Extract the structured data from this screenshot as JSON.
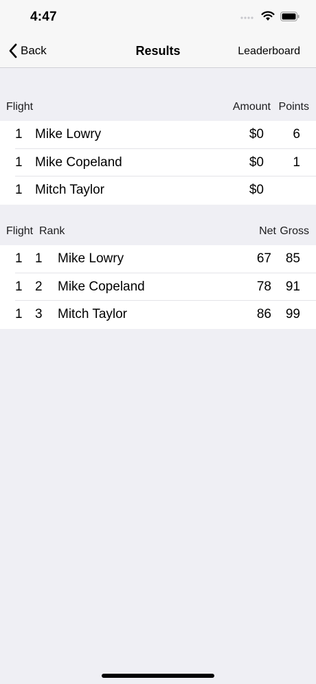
{
  "status_bar": {
    "time": "4:47"
  },
  "nav": {
    "back_label": "Back",
    "title": "Results",
    "leaderboard_label": "Leaderboard"
  },
  "payout_section": {
    "headers": {
      "flight": "Flight",
      "amount": "Amount",
      "points": "Points"
    },
    "rows": [
      {
        "flight": "1",
        "name": "Mike Lowry",
        "amount": "$0",
        "points": "6"
      },
      {
        "flight": "1",
        "name": "Mike Copeland",
        "amount": "$0",
        "points": "1"
      },
      {
        "flight": "1",
        "name": "Mitch Taylor",
        "amount": "$0",
        "points": ""
      }
    ]
  },
  "score_section": {
    "headers": {
      "flight": "Flight",
      "rank": "Rank",
      "net": "Net",
      "gross": "Gross"
    },
    "rows": [
      {
        "flight": "1",
        "rank": "1",
        "name": "Mike Lowry",
        "net": "67",
        "gross": "85"
      },
      {
        "flight": "1",
        "rank": "2",
        "name": "Mike Copeland",
        "net": "78",
        "gross": "91"
      },
      {
        "flight": "1",
        "rank": "3",
        "name": "Mitch Taylor",
        "net": "86",
        "gross": "99"
      }
    ]
  },
  "icons": [
    "signal-icon",
    "wifi-icon",
    "battery-icon",
    "chevron-left-icon"
  ]
}
